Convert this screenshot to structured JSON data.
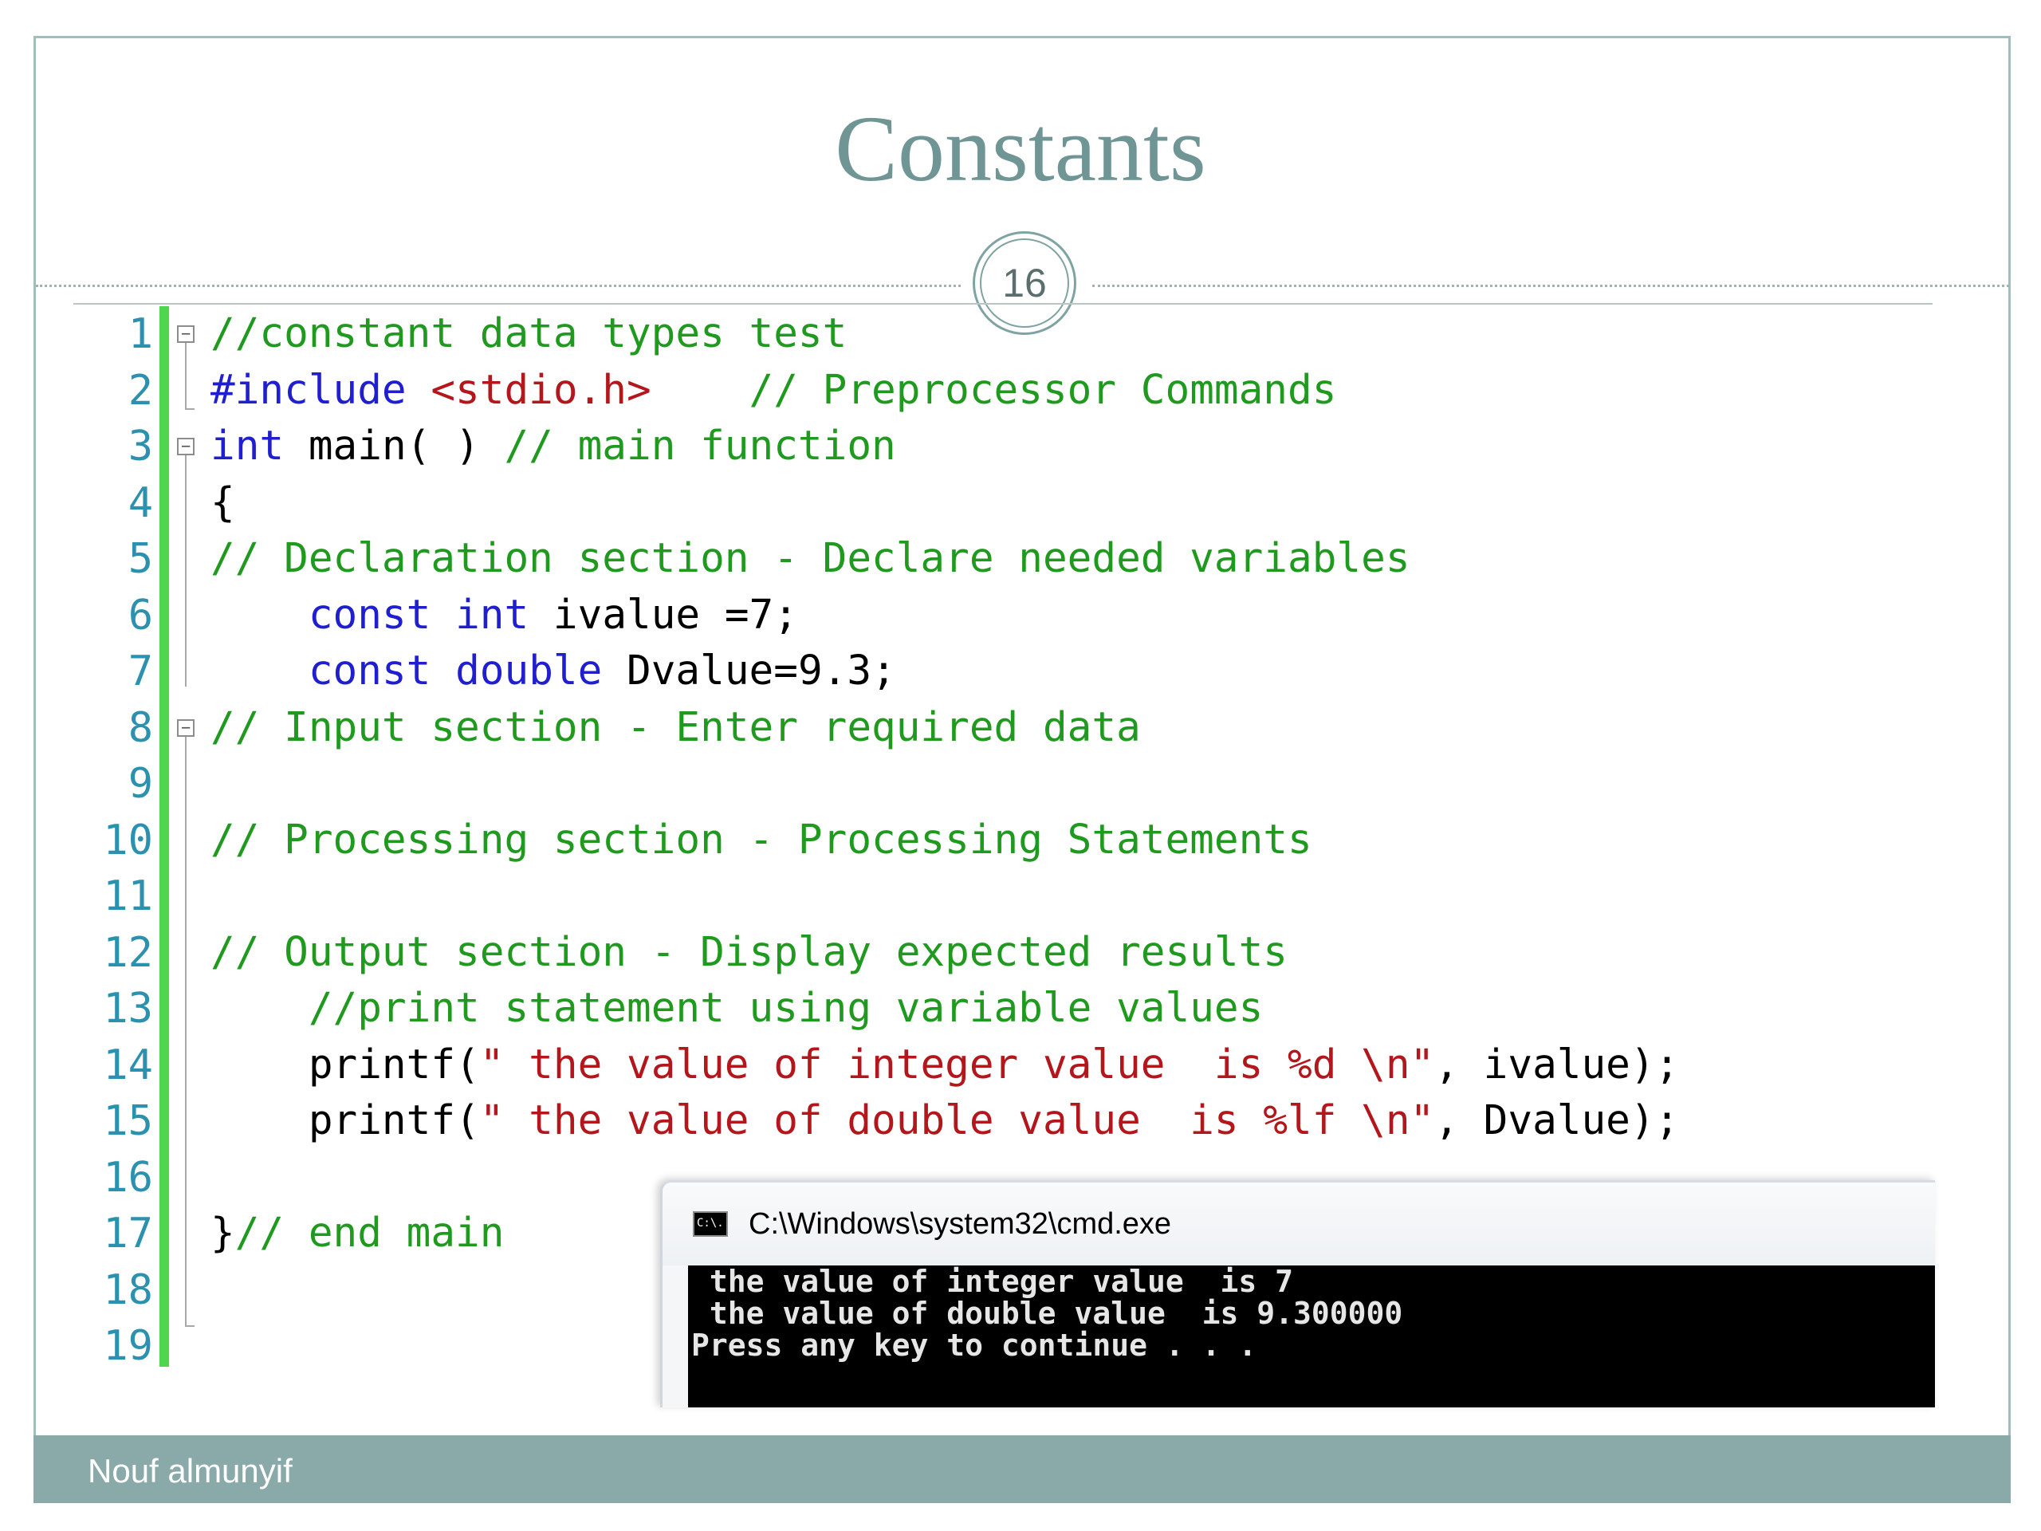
{
  "slide": {
    "title": "Constants",
    "number": "16",
    "footer": "Nouf almunyif"
  },
  "code": {
    "line_numbers": [
      "1",
      "2",
      "3",
      "4",
      "5",
      "6",
      "7",
      "8",
      "9",
      "10",
      "11",
      "12",
      "13",
      "14",
      "15",
      "16",
      "17",
      "18",
      "19"
    ],
    "lines": [
      [
        {
          "t": "//constant data types test",
          "c": "cm"
        }
      ],
      [
        {
          "t": "#include ",
          "c": "pp"
        },
        {
          "t": "<stdio.h>",
          "c": "st"
        },
        {
          "t": "    ",
          "c": "tx"
        },
        {
          "t": "// Preprocessor Commands",
          "c": "cm"
        }
      ],
      [
        {
          "t": "int",
          "c": "kw"
        },
        {
          "t": " main( ) ",
          "c": "tx"
        },
        {
          "t": "// main function",
          "c": "cm"
        }
      ],
      [
        {
          "t": "{",
          "c": "tx"
        }
      ],
      [
        {
          "t": "// Declaration section - Declare needed variables",
          "c": "cm"
        }
      ],
      [
        {
          "t": "    ",
          "c": "tx"
        },
        {
          "t": "const",
          "c": "kw"
        },
        {
          "t": " ",
          "c": "tx"
        },
        {
          "t": "int",
          "c": "kw"
        },
        {
          "t": " ivalue =7;",
          "c": "tx"
        }
      ],
      [
        {
          "t": "    ",
          "c": "tx"
        },
        {
          "t": "const",
          "c": "kw"
        },
        {
          "t": " ",
          "c": "tx"
        },
        {
          "t": "double",
          "c": "kw"
        },
        {
          "t": " Dvalue=9.3;",
          "c": "tx"
        }
      ],
      [
        {
          "t": "// Input section - Enter required data",
          "c": "cm"
        }
      ],
      [],
      [
        {
          "t": "// Processing section - Processing Statements",
          "c": "cm"
        }
      ],
      [],
      [
        {
          "t": "// Output section - Display expected results",
          "c": "cm"
        }
      ],
      [
        {
          "t": "    ",
          "c": "tx"
        },
        {
          "t": "//print statement using variable values",
          "c": "cm"
        }
      ],
      [
        {
          "t": "    printf(",
          "c": "tx"
        },
        {
          "t": "\" the value of integer value  is %d \\n\"",
          "c": "st"
        },
        {
          "t": ", ivalue);",
          "c": "tx"
        }
      ],
      [
        {
          "t": "    printf(",
          "c": "tx"
        },
        {
          "t": "\" the value of double value  is %lf \\n\"",
          "c": "st"
        },
        {
          "t": ", Dvalue);",
          "c": "tx"
        }
      ],
      [],
      [
        {
          "t": "}",
          "c": "tx"
        },
        {
          "t": "// end main",
          "c": "cm"
        }
      ],
      [],
      []
    ],
    "fold_markers": [
      "1",
      "3",
      "8"
    ]
  },
  "console": {
    "window_title": "C:\\Windows\\system32\\cmd.exe",
    "icon_label": "C:\\.",
    "output_lines": [
      " the value of integer value  is 7",
      " the value of double value  is 9.300000",
      "Press any key to continue . . ."
    ]
  },
  "colors": {
    "title": "#6f9594",
    "footer_bg": "#8aa9a9",
    "line_number": "#2b91af",
    "comment": "#1f9a1f",
    "keyword": "#1f1fd0",
    "string": "#b3161b",
    "change_bar": "#4fd64f"
  }
}
